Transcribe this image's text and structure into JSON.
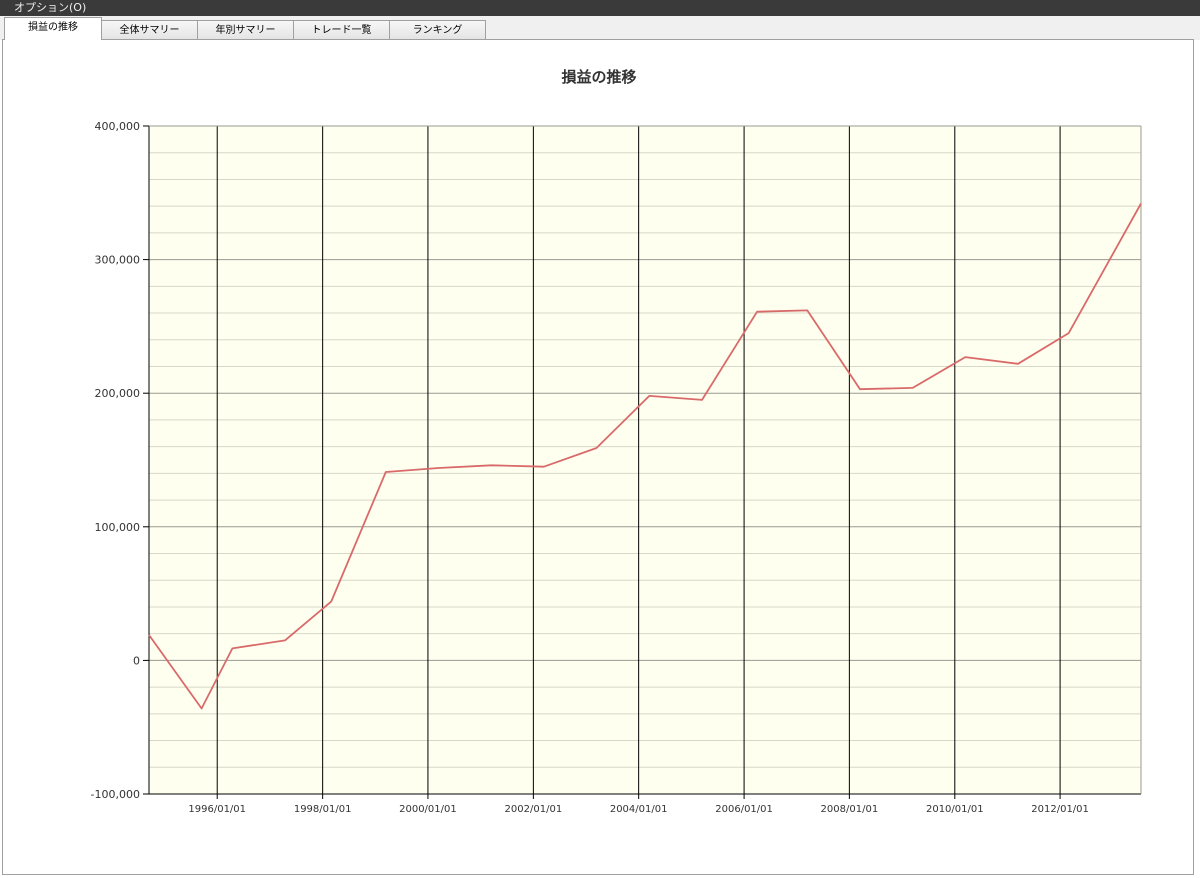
{
  "menu": {
    "label": "オプション(O)"
  },
  "tabs": [
    {
      "label": "損益の推移",
      "active": true
    },
    {
      "label": "全体サマリー",
      "active": false
    },
    {
      "label": "年別サマリー",
      "active": false
    },
    {
      "label": "トレード一覧",
      "active": false
    },
    {
      "label": "ランキング",
      "active": false
    }
  ],
  "colors": {
    "line": "#d96a6a",
    "plot_bg": "#fffff0",
    "grid_major": "#000000",
    "grid_minor": "#d8d8c8"
  },
  "chart_data": {
    "type": "line",
    "title": "損益の推移",
    "xlabel": "",
    "ylabel": "",
    "ylim": [
      -100000,
      400000
    ],
    "xlim": [
      "1994-09-15",
      "2013-07-15"
    ],
    "grid": true,
    "y_ticks": [
      "400,000",
      "300,000",
      "200,000",
      "100,000",
      "0",
      "-100,000"
    ],
    "x_ticks": [
      "1996/01/01",
      "1998/01/01",
      "2000/01/01",
      "2002/01/01",
      "2004/01/01",
      "2006/01/01",
      "2008/01/01",
      "2010/01/01",
      "2012/01/01"
    ],
    "x_tick_dates": [
      "1996-01-01",
      "1998-01-01",
      "2000-01-01",
      "2002-01-01",
      "2004-01-01",
      "2006-01-01",
      "2008-01-01",
      "2010-01-01",
      "2012-01-01"
    ],
    "series": [
      {
        "x": [
          "1994-09-15",
          "1995-09-15",
          "1996-04-15",
          "1997-04-15",
          "1998-03-01",
          "1999-03-15",
          "2000-03-15",
          "2001-03-15",
          "2002-03-15",
          "2003-03-15",
          "2004-03-15",
          "2005-03-15",
          "2006-04-01",
          "2007-03-15",
          "2008-03-15",
          "2009-03-15",
          "2010-03-15",
          "2011-03-15",
          "2012-03-01",
          "2013-07-15"
        ],
        "values": [
          19000,
          -36000,
          9000,
          15000,
          44000,
          141000,
          144000,
          146000,
          145000,
          159000,
          198000,
          195000,
          261000,
          262000,
          203000,
          204000,
          227000,
          222000,
          245000,
          342000
        ]
      }
    ]
  }
}
